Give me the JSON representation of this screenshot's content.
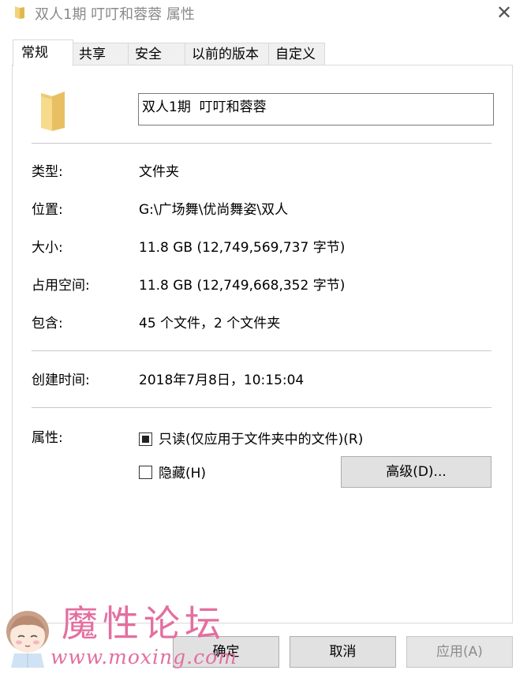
{
  "window": {
    "title": "双人1期  叮叮和蓉蓉 属性",
    "close_icon": "close-icon"
  },
  "tabs": [
    {
      "label": "常规",
      "active": true
    },
    {
      "label": "共享",
      "active": false
    },
    {
      "label": "安全",
      "active": false
    },
    {
      "label": "以前的版本",
      "active": false
    },
    {
      "label": "自定义",
      "active": false
    }
  ],
  "general": {
    "folder_name": "双人1期  叮叮和蓉蓉",
    "type_label": "类型:",
    "type_value": "文件夹",
    "location_label": "位置:",
    "location_value": "G:\\广场舞\\优尚舞姿\\双人",
    "size_label": "大小:",
    "size_value": "11.8 GB (12,749,569,737 字节)",
    "disk_size_label": "占用空间:",
    "disk_size_value": "11.8 GB (12,749,668,352 字节)",
    "contains_label": "包含:",
    "contains_value": "45 个文件，2 个文件夹",
    "created_label": "创建时间:",
    "created_value": "2018年7月8日，10:15:04",
    "attributes_label": "属性:"
  },
  "attributes": {
    "readonly_label": "只读(仅应用于文件夹中的文件)(R)",
    "readonly_state": "indeterminate",
    "hidden_label": "隐藏(H)",
    "hidden_checked": false,
    "advanced_label": "高级(D)..."
  },
  "buttons": {
    "ok": "确定",
    "cancel": "取消",
    "apply": "应用(A)"
  },
  "watermark": {
    "title": "魔性论坛",
    "url": "www.moxing.com"
  },
  "colors": {
    "folder_yellow": "#f3d27a",
    "watermark_pink": "#e46ea0"
  }
}
